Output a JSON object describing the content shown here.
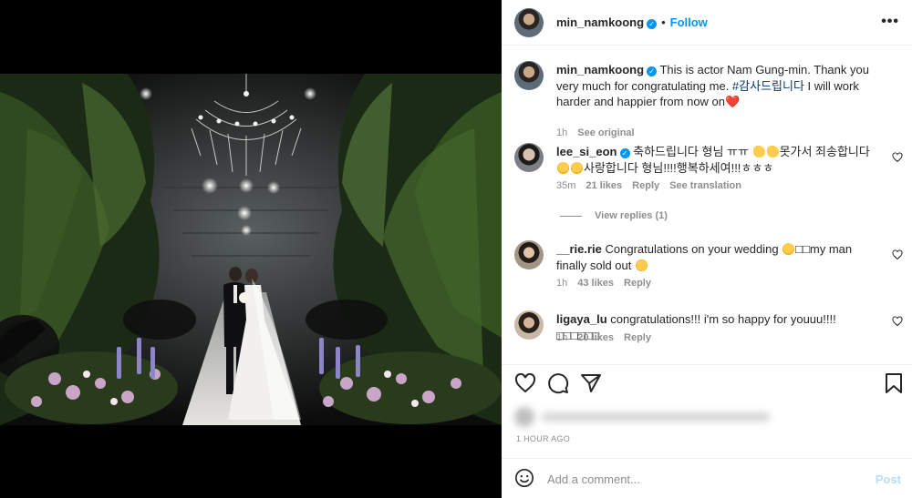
{
  "post": {
    "author": "min_namkoong",
    "follow_label": "Follow",
    "separator": "•",
    "more_icon": "more-horizontal-icon"
  },
  "caption": {
    "username": "min_namkoong",
    "text_before": " This is actor Nam Gung-min. Thank you very much for congratulating me. ",
    "hashtag": "#감사드립니다",
    "text_after": " I will work harder and happier from now on",
    "emoji": "❤️",
    "time": "1h",
    "see_original": "See original"
  },
  "comments": [
    {
      "username": "lee_si_eon",
      "verified": true,
      "text_part1": " 축하드립니다 형님 ㅠㅠ ",
      "text_part2": "못가서 죄송합니다 ",
      "text_part3": "사랑합니다 형님!!!!행복하세여!!!ㅎㅎㅎ",
      "time": "35m",
      "likes": "21 likes",
      "reply": "Reply",
      "translation": "See translation",
      "view_replies": "View replies (1)"
    },
    {
      "username": "__rie.rie",
      "text_part1": " Congratulations on your wedding ",
      "text_part2": "□□my man finally sold out ",
      "time": "1h",
      "likes": "43 likes",
      "reply": "Reply"
    },
    {
      "username": "ligaya_lu",
      "text": " congratulations!!! i'm so happy for youuu!!!! □□□□□□",
      "time": "1h",
      "likes": "20 likes",
      "reply": "Reply"
    }
  ],
  "actions": {
    "like_icon": "heart-icon",
    "comment_icon": "comment-icon",
    "share_icon": "paper-plane-icon",
    "save_icon": "bookmark-icon",
    "time_ago": "1 HOUR AGO"
  },
  "add_comment": {
    "placeholder": "Add a comment...",
    "post_label": "Post"
  },
  "colors": {
    "accent": "#0095f6",
    "hashtag": "#00376b",
    "muted": "#8e8e8e",
    "heart_red": "#ed4956"
  }
}
